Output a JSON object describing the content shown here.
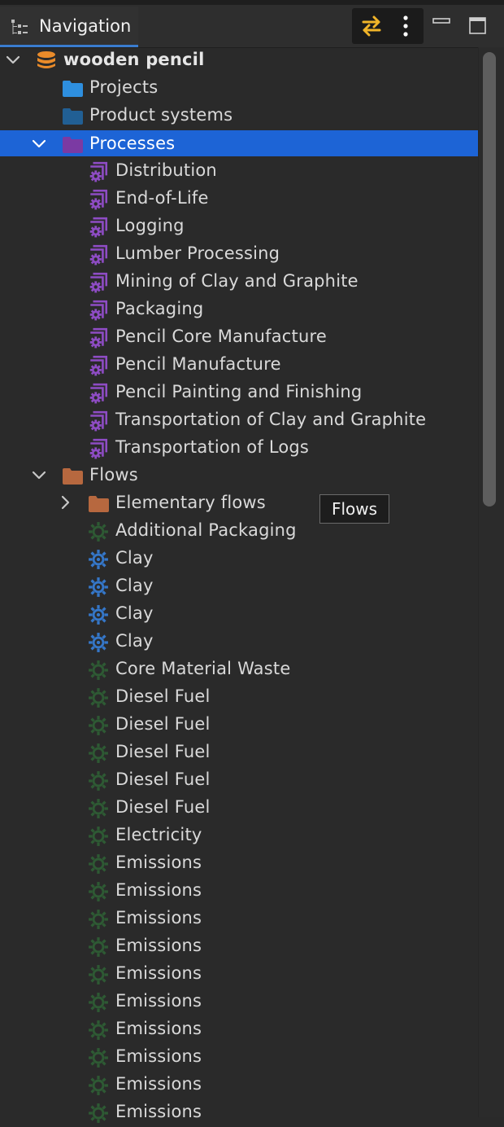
{
  "panel": {
    "title": "Navigation"
  },
  "tooltip": "Flows",
  "colors": {
    "selection": "#1d64d6",
    "database": "#e98b2a",
    "projects_folder": "#2e8fdf",
    "product_systems_folder": "#215f94",
    "processes_folder": "#7b3aa3",
    "flows_folder": "#b7683f",
    "process_icon": "#8e4cc4",
    "product_flow_icon": "#3577c9",
    "waste_flow_icon": "#2e5a34"
  },
  "tree": [
    {
      "label": "wooden pencil",
      "level": 0,
      "icon": "database-icon",
      "expanded": true,
      "bold": true
    },
    {
      "label": "Projects",
      "level": 1,
      "icon": "folder-projects-icon"
    },
    {
      "label": "Product systems",
      "level": 1,
      "icon": "folder-product-systems-icon"
    },
    {
      "label": "Processes",
      "level": 1,
      "icon": "folder-processes-icon",
      "expanded": true,
      "selected": true
    },
    {
      "label": "Distribution",
      "level": 2,
      "icon": "process-icon"
    },
    {
      "label": "End-of-Life",
      "level": 2,
      "icon": "process-icon"
    },
    {
      "label": "Logging",
      "level": 2,
      "icon": "process-icon"
    },
    {
      "label": "Lumber Processing",
      "level": 2,
      "icon": "process-icon"
    },
    {
      "label": "Mining of Clay and Graphite",
      "level": 2,
      "icon": "process-icon"
    },
    {
      "label": "Packaging",
      "level": 2,
      "icon": "process-icon"
    },
    {
      "label": "Pencil Core Manufacture",
      "level": 2,
      "icon": "process-icon"
    },
    {
      "label": "Pencil Manufacture",
      "level": 2,
      "icon": "process-icon"
    },
    {
      "label": "Pencil Painting and Finishing",
      "level": 2,
      "icon": "process-icon"
    },
    {
      "label": "Transportation of Clay and Graphite",
      "level": 2,
      "icon": "process-icon"
    },
    {
      "label": "Transportation of Logs",
      "level": 2,
      "icon": "process-icon"
    },
    {
      "label": "Flows",
      "level": 1,
      "icon": "folder-flows-icon",
      "expanded": true
    },
    {
      "label": "Elementary flows",
      "level": 2,
      "icon": "folder-flows-icon",
      "expanded": false
    },
    {
      "label": "Additional Packaging",
      "level": 2,
      "icon": "waste-flow-icon"
    },
    {
      "label": "Clay",
      "level": 2,
      "icon": "product-flow-icon"
    },
    {
      "label": "Clay",
      "level": 2,
      "icon": "product-flow-icon"
    },
    {
      "label": "Clay",
      "level": 2,
      "icon": "product-flow-icon"
    },
    {
      "label": "Clay",
      "level": 2,
      "icon": "product-flow-icon"
    },
    {
      "label": "Core Material Waste",
      "level": 2,
      "icon": "waste-flow-icon"
    },
    {
      "label": "Diesel Fuel",
      "level": 2,
      "icon": "waste-flow-icon"
    },
    {
      "label": "Diesel Fuel",
      "level": 2,
      "icon": "waste-flow-icon"
    },
    {
      "label": "Diesel Fuel",
      "level": 2,
      "icon": "waste-flow-icon"
    },
    {
      "label": "Diesel Fuel",
      "level": 2,
      "icon": "waste-flow-icon"
    },
    {
      "label": "Diesel Fuel",
      "level": 2,
      "icon": "waste-flow-icon"
    },
    {
      "label": "Electricity",
      "level": 2,
      "icon": "waste-flow-icon"
    },
    {
      "label": "Emissions",
      "level": 2,
      "icon": "waste-flow-icon"
    },
    {
      "label": "Emissions",
      "level": 2,
      "icon": "waste-flow-icon"
    },
    {
      "label": "Emissions",
      "level": 2,
      "icon": "waste-flow-icon"
    },
    {
      "label": "Emissions",
      "level": 2,
      "icon": "waste-flow-icon"
    },
    {
      "label": "Emissions",
      "level": 2,
      "icon": "waste-flow-icon"
    },
    {
      "label": "Emissions",
      "level": 2,
      "icon": "waste-flow-icon"
    },
    {
      "label": "Emissions",
      "level": 2,
      "icon": "waste-flow-icon"
    },
    {
      "label": "Emissions",
      "level": 2,
      "icon": "waste-flow-icon"
    },
    {
      "label": "Emissions",
      "level": 2,
      "icon": "waste-flow-icon"
    },
    {
      "label": "Emissions",
      "level": 2,
      "icon": "waste-flow-icon"
    }
  ]
}
